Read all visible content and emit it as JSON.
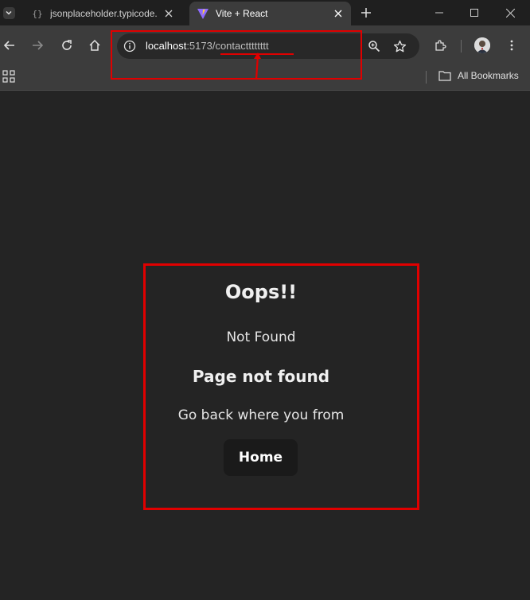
{
  "browser": {
    "tabs": [
      {
        "title": "jsonplaceholder.typicode.",
        "active": false,
        "favicon": "braces-icon"
      },
      {
        "title": "Vite + React",
        "active": true,
        "favicon": "vite-logo-icon"
      }
    ],
    "address_bar": {
      "host": "localhost",
      "port_path": ":5173/contactttttttt"
    },
    "bookmarks_bar": {
      "all_bookmarks_label": "All Bookmarks"
    }
  },
  "page": {
    "heading": "Oops!!",
    "status_text": "Not Found",
    "subheading": "Page not found",
    "message": "Go back where you from",
    "home_button_label": "Home"
  },
  "colors": {
    "annotation": "#e00000",
    "page_background": "#242424",
    "button_background": "#1a1a1a"
  }
}
